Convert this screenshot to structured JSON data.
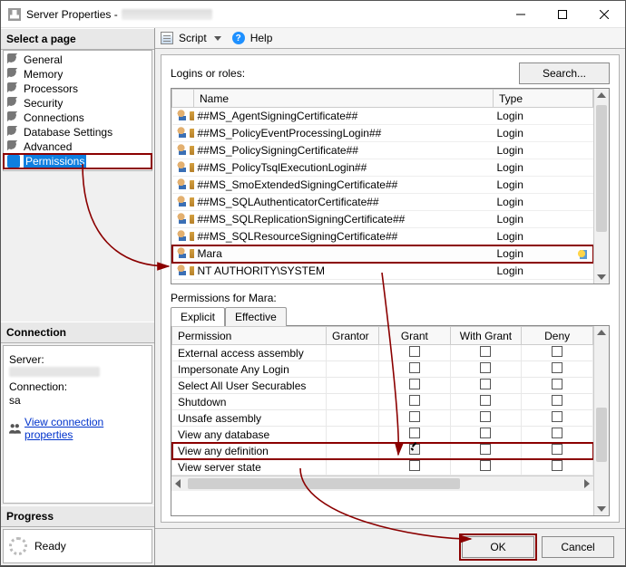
{
  "titlebar": {
    "prefix": "Server Properties -"
  },
  "toolbar": {
    "script": "Script",
    "help": "Help"
  },
  "sidebar": {
    "head_pages": "Select a page",
    "items": [
      {
        "label": "General"
      },
      {
        "label": "Memory"
      },
      {
        "label": "Processors"
      },
      {
        "label": "Security"
      },
      {
        "label": "Connections"
      },
      {
        "label": "Database Settings"
      },
      {
        "label": "Advanced"
      },
      {
        "label": "Permissions",
        "selected": true
      }
    ],
    "head_conn": "Connection",
    "server_label": "Server:",
    "conn_label": "Connection:",
    "conn_value": "sa",
    "view_conn_link": "View connection properties",
    "head_progress": "Progress",
    "ready": "Ready"
  },
  "logins": {
    "label": "Logins or roles:",
    "search": "Search...",
    "col_name": "Name",
    "col_type": "Type",
    "rows": [
      {
        "name": "##MS_AgentSigningCertificate##",
        "type": "Login"
      },
      {
        "name": "##MS_PolicyEventProcessingLogin##",
        "type": "Login"
      },
      {
        "name": "##MS_PolicySigningCertificate##",
        "type": "Login"
      },
      {
        "name": "##MS_PolicyTsqlExecutionLogin##",
        "type": "Login"
      },
      {
        "name": "##MS_SmoExtendedSigningCertificate##",
        "type": "Login"
      },
      {
        "name": "##MS_SQLAuthenticatorCertificate##",
        "type": "Login"
      },
      {
        "name": "##MS_SQLReplicationSigningCertificate##",
        "type": "Login"
      },
      {
        "name": "##MS_SQLResourceSigningCertificate##",
        "type": "Login"
      },
      {
        "name": "Mara",
        "type": "Login",
        "selected": true
      },
      {
        "name": "NT AUTHORITY\\SYSTEM",
        "type": "Login"
      }
    ]
  },
  "perms": {
    "label": "Permissions for Mara:",
    "tab_explicit": "Explicit",
    "tab_effective": "Effective",
    "col_perm": "Permission",
    "col_grantor": "Grantor",
    "col_grant": "Grant",
    "col_withgrant": "With Grant",
    "col_deny": "Deny",
    "rows": [
      {
        "perm": "External access assembly",
        "grant": false,
        "with": false,
        "deny": false
      },
      {
        "perm": "Impersonate Any Login",
        "grant": false,
        "with": false,
        "deny": false
      },
      {
        "perm": "Select All User Securables",
        "grant": false,
        "with": false,
        "deny": false
      },
      {
        "perm": "Shutdown",
        "grant": false,
        "with": false,
        "deny": false
      },
      {
        "perm": "Unsafe assembly",
        "grant": false,
        "with": false,
        "deny": false
      },
      {
        "perm": "View any database",
        "grant": false,
        "with": false,
        "deny": false
      },
      {
        "perm": "View any definition",
        "grant": true,
        "with": false,
        "deny": false,
        "selected": true
      },
      {
        "perm": "View server state",
        "grant": false,
        "with": false,
        "deny": false
      }
    ]
  },
  "buttons": {
    "ok": "OK",
    "cancel": "Cancel"
  }
}
